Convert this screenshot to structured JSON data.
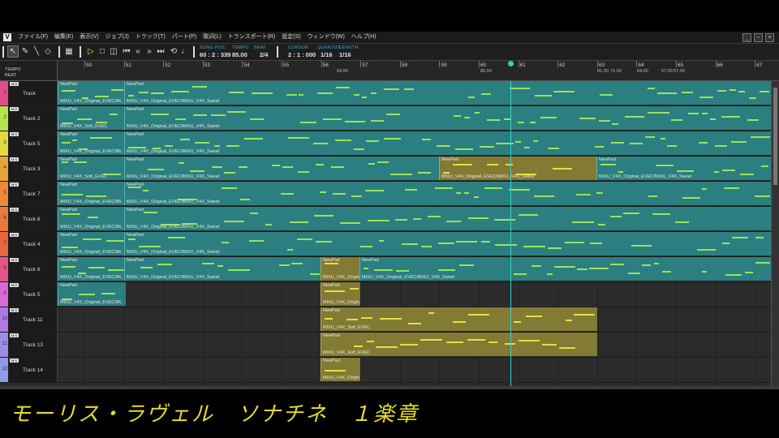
{
  "menu": [
    "ファイル(F)",
    "編集(E)",
    "表示(V)",
    "ジョブ(J)",
    "トラック(T)",
    "パート(P)",
    "歌詞(L)",
    "トランスポート(R)",
    "設定(S)",
    "ウィンドウ(W)",
    "ヘルプ(H)"
  ],
  "app_icon": "V",
  "window_controls": [
    "_",
    "▫",
    "×"
  ],
  "toolbar": {
    "song_pos_label": "SONG POS.",
    "song_pos_value": "60 : 2 : 339",
    "tempo_label": "TEMPO",
    "tempo_value": "85.00",
    "beat_label": "BEAT",
    "beat_value": "2/4",
    "cursor_label": "CURSOR",
    "cursor_value": "2 : 1 : 000",
    "quantize_label": "QUANTIZE",
    "quantize_value": "1/16",
    "length_label": "LENGTH",
    "length_value": "1/16"
  },
  "ruler": {
    "tempo_label": "TEMPO",
    "beat_label": "BEAT",
    "bars": [
      "50",
      "51",
      "52",
      "53",
      "54",
      "55",
      "56",
      "57",
      "58",
      "59",
      "60",
      "61",
      "62",
      "63",
      "64",
      "65",
      "66",
      "67"
    ],
    "tempo_marks": [
      "64.00",
      "85.00",
      "81.00",
      "71.00",
      "64.00",
      "57.00",
      "57.00"
    ]
  },
  "tracks": [
    {
      "num": "1",
      "name": "Track",
      "color": "#e24d8a",
      "parts": [
        {
          "name": "NewPart",
          "singer": "MIXU_V4X_Original_EVEC/ML",
          "type": "teal"
        },
        {
          "name": "NewPart",
          "singer": "MIXU_V4X_Original_EVEC/MIXU_V4X_Sweet",
          "type": "teal"
        }
      ]
    },
    {
      "num": "2",
      "name": "Track 2",
      "color": "#b4e44a",
      "parts": [
        {
          "name": "NewPart",
          "singer": "MIXU_V4X_Soft_EVEC",
          "type": "teal"
        },
        {
          "name": "NewPart",
          "singer": "MIXU_V4X_Original_EVEC/MIXU_V4X_Sweet",
          "type": "teal"
        }
      ]
    },
    {
      "num": "3",
      "name": "Track 5",
      "color": "#e6d844",
      "parts": [
        {
          "name": "NewPart",
          "singer": "MIXU_V4X_Original_EVEC/ML",
          "type": "teal"
        },
        {
          "name": "NewPart",
          "singer": "MIXU_V4X_Original_EVEC/MIXU_V4X_Sweet",
          "type": "teal"
        }
      ]
    },
    {
      "num": "4",
      "name": "Track 3",
      "color": "#e8a23c",
      "parts": [
        {
          "name": "NewPart",
          "singer": "MIXU_V4X_Soft_EVEC",
          "type": "teal"
        },
        {
          "name": "NewPart",
          "singer": "MIXU_V4X_Original_EVEC/MIXU_V4X_Sweet",
          "type": "teal"
        },
        {
          "name": "NewPart",
          "singer": "MIXU_V4X_Original_EVEC/MIXU_V4X_Sweet",
          "type": "olive"
        },
        {
          "name": "NewPart",
          "singer": "MIXU_V4X_Original_EVEC/MIXU_V4X_Sweet",
          "type": "teal"
        }
      ]
    },
    {
      "num": "5",
      "name": "Track 7",
      "color": "#e88a3a",
      "parts": [
        {
          "name": "NewPart",
          "singer": "MIXU_V4X_Original_EVEC/ML",
          "type": "teal"
        },
        {
          "name": "NewPart",
          "singer": "MIXU_V4X_Original_EVEC/MIXU_V4X_Sweet",
          "type": "teal"
        }
      ]
    },
    {
      "num": "6",
      "name": "Track 8",
      "color": "#e87a3a",
      "parts": [
        {
          "name": "NewPart",
          "singer": "MIXU_V4X_Original_EVEC/ML",
          "type": "teal"
        },
        {
          "name": "NewPart",
          "singer": "MIXU_V4X_Original_EVEC/MIXU_V4X_Sweet",
          "type": "teal"
        }
      ]
    },
    {
      "num": "7",
      "name": "Track 4",
      "color": "#e8663a",
      "parts": [
        {
          "name": "NewPart",
          "singer": "MIXU_V4X_Original_EVEC/ML",
          "type": "teal"
        },
        {
          "name": "NewPart",
          "singer": "MIXU_V4X_Original_EVEC/MIXU_V4X_Sweet",
          "type": "teal"
        }
      ]
    },
    {
      "num": "8",
      "name": "Track 6",
      "color": "#e2558a",
      "parts": [
        {
          "name": "NewPart",
          "singer": "MIXU_V4X_Original_EVEC/ML",
          "type": "teal"
        },
        {
          "name": "NewPart",
          "singer": "MIXU_V4X_Original_EVEC/MIXU_V4X_Sweet",
          "type": "teal"
        },
        {
          "name": "NewPart",
          "singer": "MIXU_V4X_Origin",
          "type": "olive"
        },
        {
          "name": "NewPart",
          "singer": "MIXU_V4X_Original_EVEC/MIXU_V4X_Sweet",
          "type": "teal"
        }
      ]
    },
    {
      "num": "9",
      "name": "Track 5",
      "color": "#d86ad6",
      "parts": [
        {
          "name": "NewPart",
          "singer": "MIXU_V4X_Original_EVEC/ML",
          "type": "teal"
        },
        {
          "name": "NewPart",
          "singer": "MIXU_V4X_Origin",
          "type": "olive"
        }
      ]
    },
    {
      "num": "10",
      "name": "Track 11",
      "color": "#b07ae4",
      "parts": [
        {
          "name": "NewPart",
          "singer": "MIXU_V4X_Soft_EVEC",
          "type": "olive"
        }
      ]
    },
    {
      "num": "11",
      "name": "Track 13",
      "color": "#9a8ce8",
      "parts": [
        {
          "name": "NewPart",
          "singer": "MIXU_V4X_Soft_EVEC",
          "type": "olive"
        }
      ]
    },
    {
      "num": "12",
      "name": "Track 14",
      "color": "#8c9ce8",
      "parts": [
        {
          "name": "NewPart",
          "singer": "MIXU_V4X_Origin",
          "type": "olive"
        }
      ]
    }
  ],
  "caption": "モーリス・ラヴェル　ソナチネ　１楽章"
}
